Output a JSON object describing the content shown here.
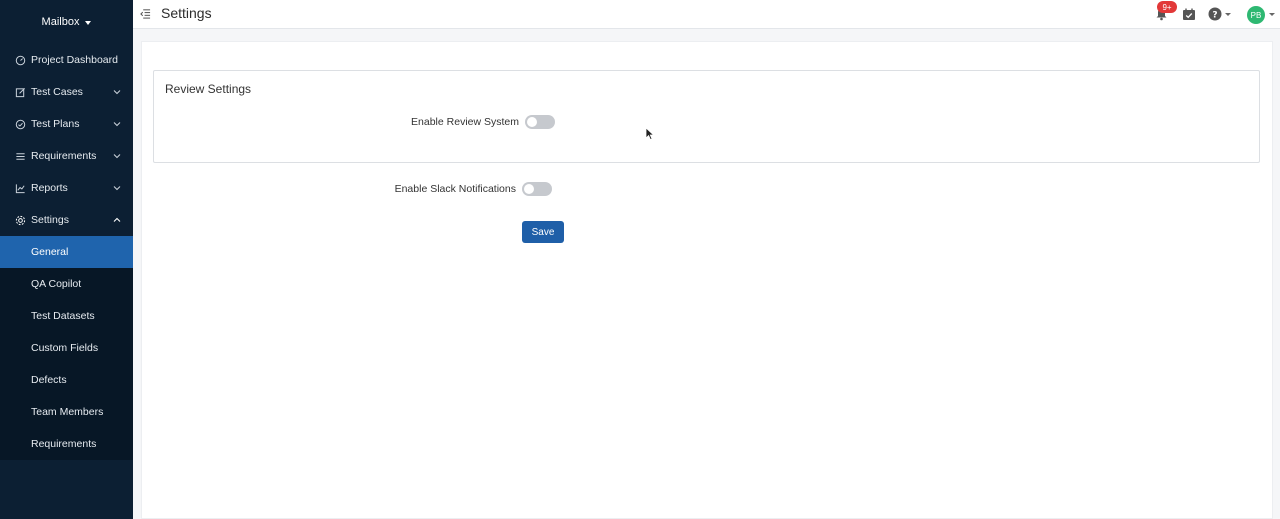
{
  "sidebar": {
    "project_name": "Mailbox",
    "items": [
      {
        "label": "Project Dashboard",
        "icon": "dashboard-icon"
      },
      {
        "label": "Test Cases",
        "icon": "edit-icon"
      },
      {
        "label": "Test Plans",
        "icon": "check-circle-icon"
      },
      {
        "label": "Requirements",
        "icon": "list-icon"
      },
      {
        "label": "Reports",
        "icon": "chart-icon"
      },
      {
        "label": "Settings",
        "icon": "gear-icon"
      }
    ],
    "settings_sub": [
      {
        "label": "General",
        "active": true
      },
      {
        "label": "QA Copilot"
      },
      {
        "label": "Test Datasets"
      },
      {
        "label": "Custom Fields"
      },
      {
        "label": "Defects"
      },
      {
        "label": "Team Members"
      },
      {
        "label": "Requirements"
      }
    ]
  },
  "header": {
    "title": "Settings",
    "notification_badge": "9+",
    "avatar_initials": "PB"
  },
  "main": {
    "review_panel_title": "Review Settings",
    "review_toggle_label": "Enable Review System",
    "slack_toggle_label": "Enable Slack Notifications",
    "save_label": "Save"
  },
  "colors": {
    "sidebar_bg": "#0c1f33",
    "active_bg": "#1f64ad",
    "primary": "#1f5fa8",
    "badge": "#e23838",
    "avatar": "#2eb872"
  }
}
